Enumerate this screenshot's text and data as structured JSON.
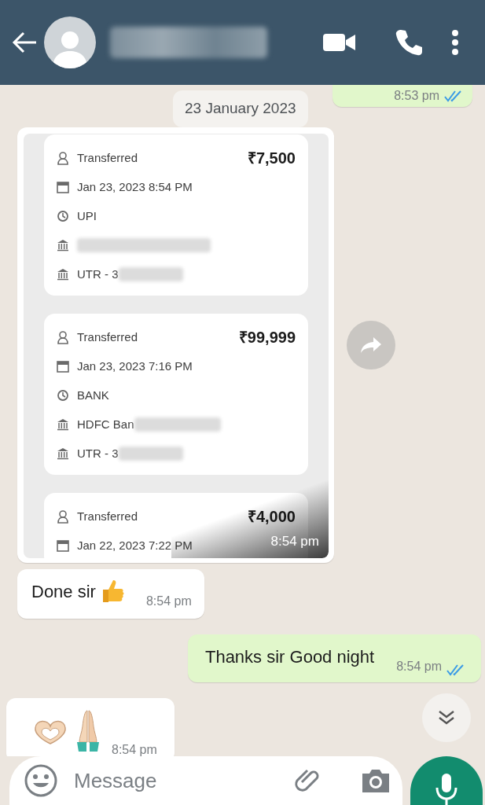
{
  "header": {
    "contact_name_hidden": true
  },
  "messages": [
    {
      "kind": "outgoing_tail",
      "time": "8:53 pm",
      "read": true
    },
    {
      "kind": "date",
      "text": "23 January 2023"
    },
    {
      "kind": "receipts",
      "time": "8:54 pm",
      "receipts": [
        {
          "status": "Transferred",
          "amount": "₹7,500",
          "date": "Jan 23, 2023 8:54 PM",
          "method": "UPI",
          "bank_hidden": true,
          "utr": "UTR - 3"
        },
        {
          "status": "Transferred",
          "amount": "₹99,999",
          "date": "Jan 23, 2023 7:16 PM",
          "method": "BANK",
          "bank": "HDFC Ban",
          "bank_hidden": true,
          "utr": "UTR - 3"
        },
        {
          "status": "Transferred",
          "amount": "₹4,000",
          "date": "Jan 22, 2023 7:22 PM"
        }
      ]
    },
    {
      "kind": "incoming",
      "text": "Done sir",
      "emoji": [
        {
          "kind": "thumbs_up"
        }
      ],
      "time": "8:54 pm"
    },
    {
      "kind": "outgoing",
      "text": "Thanks sir Good night",
      "time": "8:54 pm",
      "read": true
    },
    {
      "kind": "incoming",
      "emoji": [
        {
          "kind": "heart_hands"
        },
        {
          "kind": "praying_hands"
        }
      ],
      "time": "8:54 pm"
    }
  ],
  "composer": {
    "placeholder": "Message"
  }
}
